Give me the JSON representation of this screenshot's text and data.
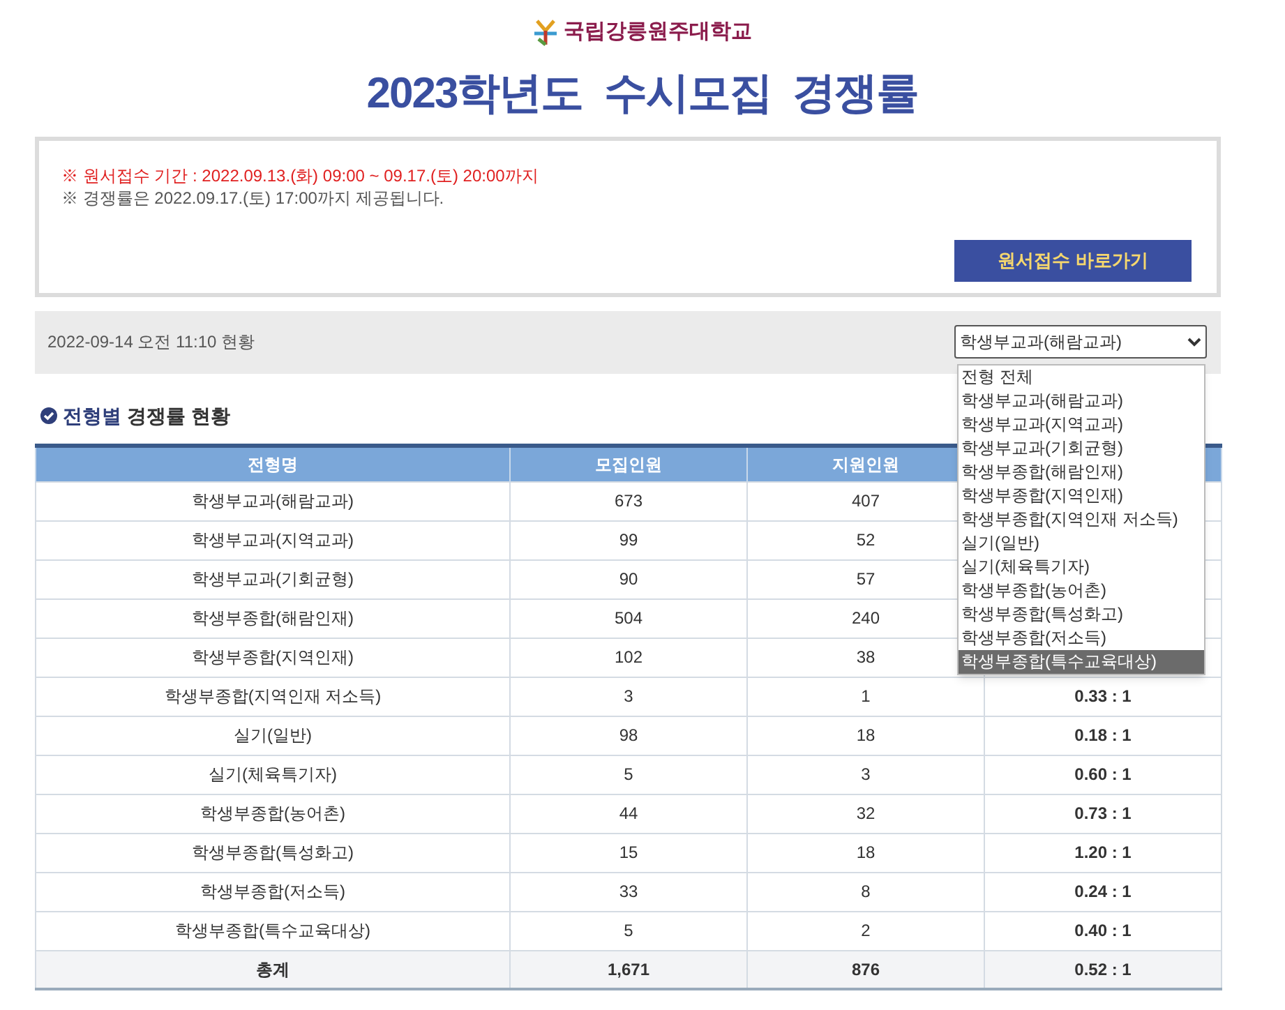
{
  "logo": {
    "text": "국립강릉원주대학교"
  },
  "title": "2023학년도  수시모집  경쟁률",
  "notice": {
    "lines": [
      {
        "kind": "alert",
        "text": "※ 원서접수 기간 : 2022.09.13.(화) 09:00 ~ 09.17.(토) 20:00까지"
      },
      {
        "kind": "info",
        "text": "※ 경쟁률은 2022.09.17.(토) 17:00까지 제공됩니다."
      }
    ],
    "button": "원서접수 바로가기"
  },
  "status": {
    "text": "2022-09-14 오전 11:10 현황",
    "select": {
      "value": "학생부교과(해람교과)",
      "expanded": true,
      "options": [
        {
          "label": "전형 전체",
          "highlighted": false
        },
        {
          "label": "학생부교과(해람교과)",
          "highlighted": false
        },
        {
          "label": "학생부교과(지역교과)",
          "highlighted": false
        },
        {
          "label": "학생부교과(기회균형)",
          "highlighted": false
        },
        {
          "label": "학생부종합(해람인재)",
          "highlighted": false
        },
        {
          "label": "학생부종합(지역인재)",
          "highlighted": false
        },
        {
          "label": "학생부종합(지역인재 저소득)",
          "highlighted": false
        },
        {
          "label": "실기(일반)",
          "highlighted": false
        },
        {
          "label": "실기(체육특기자)",
          "highlighted": false
        },
        {
          "label": "학생부종합(농어촌)",
          "highlighted": false
        },
        {
          "label": "학생부종합(특성화고)",
          "highlighted": false
        },
        {
          "label": "학생부종합(저소득)",
          "highlighted": false
        },
        {
          "label": "학생부종합(특수교육대상)",
          "highlighted": true
        }
      ]
    }
  },
  "section": {
    "highlight": "전형별",
    "rest": "경쟁률 현황"
  },
  "table": {
    "columns": [
      "전형명",
      "모집인원",
      "지원인원"
    ],
    "rows": [
      {
        "cells": [
          "학생부교과(해람교과)",
          "673",
          "407"
        ]
      },
      {
        "cells": [
          "학생부교과(지역교과)",
          "99",
          "52"
        ]
      },
      {
        "cells": [
          "학생부교과(기회균형)",
          "90",
          "57"
        ]
      },
      {
        "cells": [
          "학생부종합(해람인재)",
          "504",
          "240"
        ]
      },
      {
        "cells": [
          "학생부종합(지역인재)",
          "102",
          "38"
        ]
      },
      {
        "cells": [
          "학생부종합(지역인재 저소득)",
          "3",
          "1",
          "0.33 : 1"
        ]
      },
      {
        "cells": [
          "실기(일반)",
          "98",
          "18",
          "0.18 : 1"
        ]
      },
      {
        "cells": [
          "실기(체육특기자)",
          "5",
          "3",
          "0.60 : 1"
        ]
      },
      {
        "cells": [
          "학생부종합(농어촌)",
          "44",
          "32",
          "0.73 : 1"
        ]
      },
      {
        "cells": [
          "학생부종합(특성화고)",
          "15",
          "18",
          "1.20 : 1"
        ]
      },
      {
        "cells": [
          "학생부종합(저소득)",
          "33",
          "8",
          "0.24 : 1"
        ]
      },
      {
        "cells": [
          "학생부종합(특수교육대상)",
          "5",
          "2",
          "0.40 : 1"
        ]
      }
    ],
    "total": [
      "총계",
      "1,671",
      "876",
      "0.52 : 1"
    ]
  }
}
